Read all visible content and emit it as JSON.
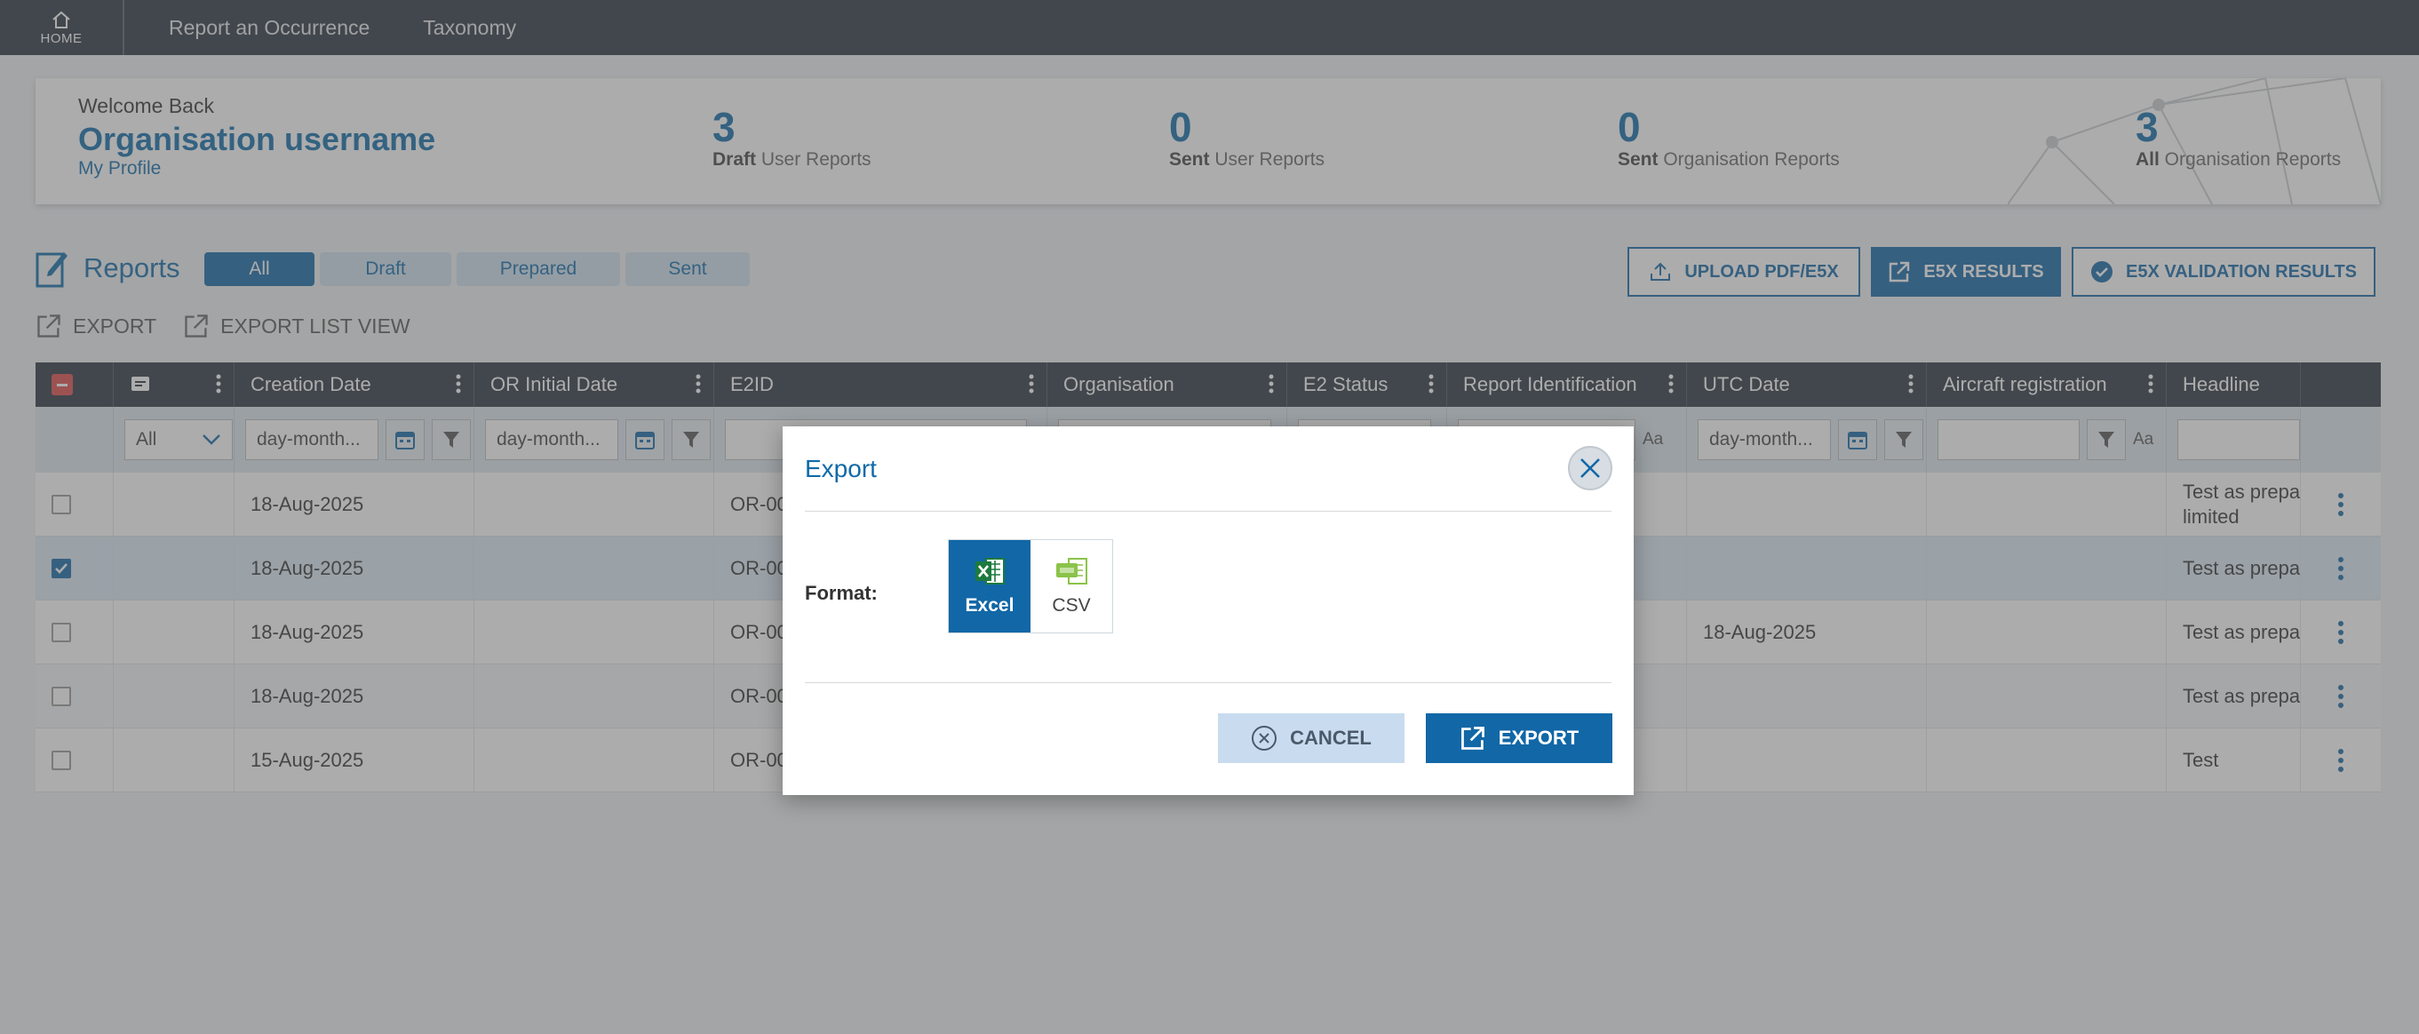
{
  "topbar": {
    "home": "HOME",
    "nav": [
      "Report an Occurrence",
      "Taxonomy"
    ]
  },
  "welcome": {
    "greeting": "Welcome Back",
    "username": "Organisation username",
    "profile_link": "My Profile",
    "stats": [
      {
        "count": "3",
        "bold": "Draft",
        "label": " User Reports"
      },
      {
        "count": "0",
        "bold": "Sent",
        "label": " User Reports"
      },
      {
        "count": "0",
        "bold": "Sent",
        "label": " Organisation Reports"
      },
      {
        "count": "3",
        "bold": "All",
        "label": " Organisation Reports"
      }
    ]
  },
  "reports": {
    "title": "Reports",
    "tabs": [
      "All",
      "Draft",
      "Prepared",
      "Sent"
    ],
    "active_tab": "All",
    "buttons": {
      "upload": "UPLOAD PDF/E5X",
      "results": "E5X RESULTS",
      "validation": "E5X VALIDATION RESULTS"
    },
    "export": "EXPORT",
    "export_list": "EXPORT LIST VIEW"
  },
  "grid": {
    "columns": [
      "Creation Date",
      "OR Initial Date",
      "E2ID",
      "Organisation",
      "E2 Status",
      "Report Identification",
      "UTC Date",
      "Aircraft registration",
      "Headline"
    ],
    "filters": {
      "select_value": "All",
      "date_placeholder": "day-month...",
      "aa": "Aa"
    },
    "rows": [
      {
        "creation": "18-Aug-2025",
        "e2id": "OR-00",
        "utc": "",
        "headline": "Test as prepara",
        "headline2": "limited",
        "checked": false
      },
      {
        "creation": "18-Aug-2025",
        "e2id": "OR-00",
        "utc": "",
        "headline": "Test as prepara",
        "headline2": "",
        "checked": true
      },
      {
        "creation": "18-Aug-2025",
        "e2id": "OR-00",
        "utc": "18-Aug-2025",
        "headline": "Test as prepara",
        "headline2": "",
        "checked": false
      },
      {
        "creation": "18-Aug-2025",
        "e2id": "OR-00",
        "utc": "",
        "headline": "Test as prepara",
        "headline2": "",
        "checked": false
      },
      {
        "creation": "15-Aug-2025",
        "e2id": "OR-00",
        "utc": "",
        "headline": "Test",
        "headline2": "",
        "checked": false
      }
    ]
  },
  "modal": {
    "title": "Export",
    "format_label": "Format:",
    "formats": [
      "Excel",
      "CSV"
    ],
    "selected_format": "Excel",
    "cancel": "CANCEL",
    "export": "EXPORT"
  },
  "colors": {
    "primary": "#1267a6",
    "topbar": "#2b3540",
    "excel_green": "#1d7a3e",
    "csv_green": "#8bc34a"
  }
}
